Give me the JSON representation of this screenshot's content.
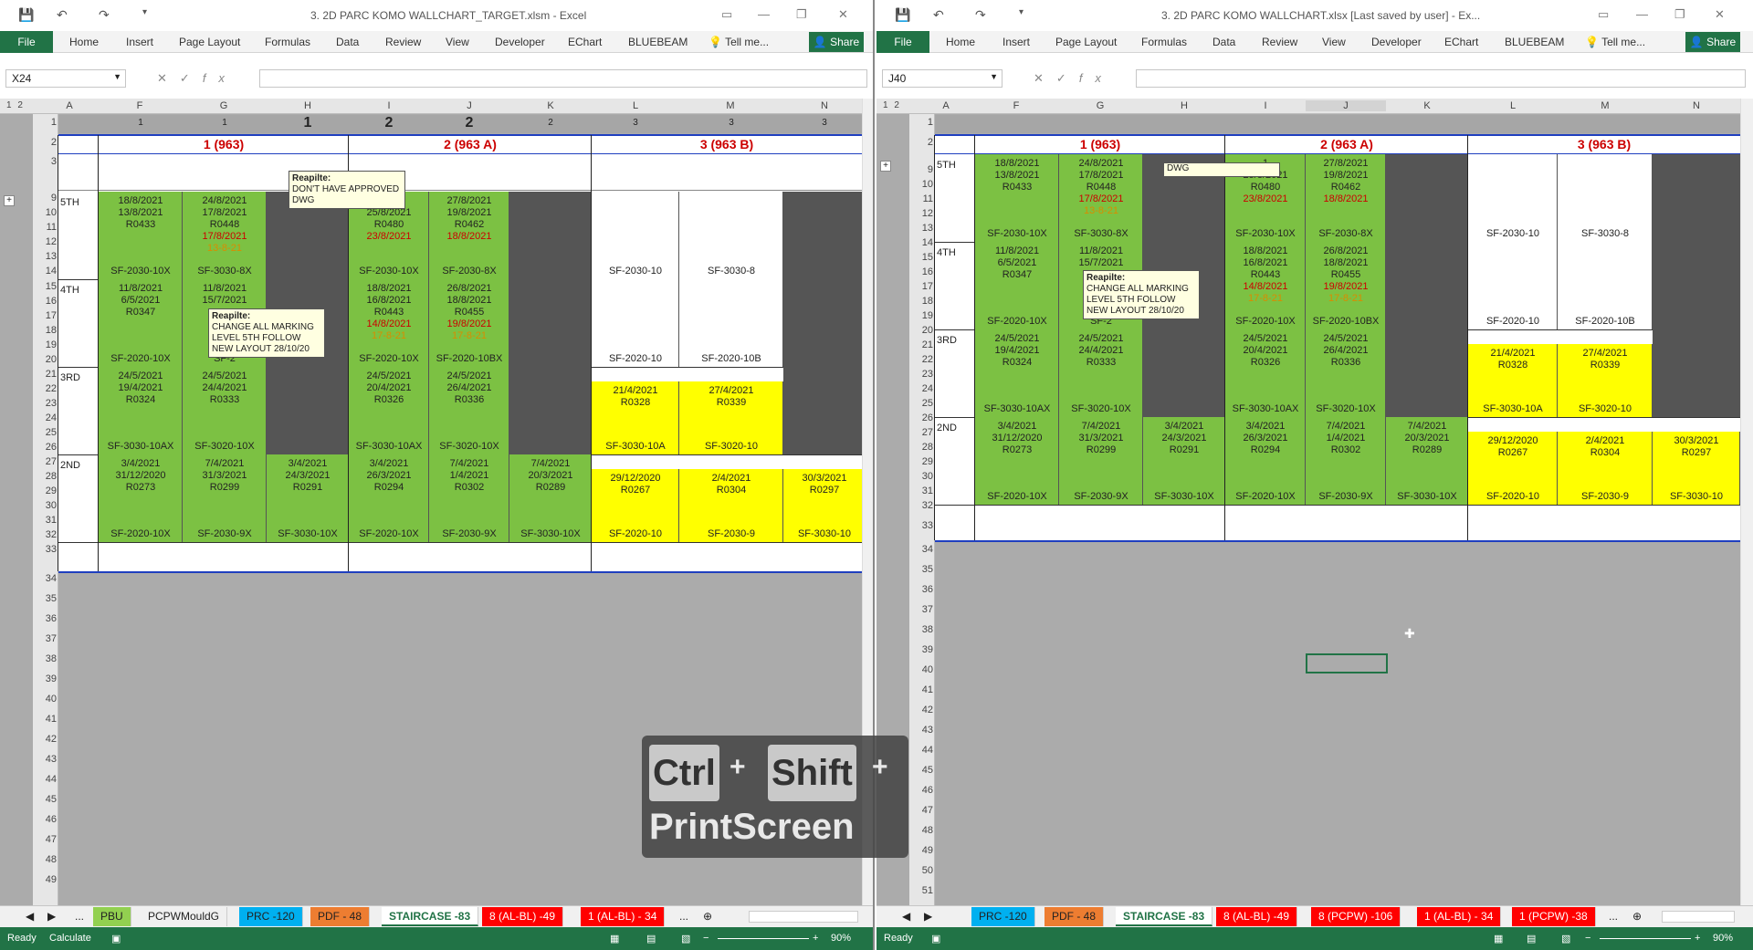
{
  "left": {
    "title": "3. 2D PARC KOMO WALLCHART_TARGET.xlsm - Excel",
    "name_box": "X24",
    "cols": [
      "A",
      "F",
      "G",
      "H",
      "I",
      "J",
      "K",
      "L",
      "M",
      "N"
    ],
    "tabs": [
      "PBU",
      "PCPWMouldG",
      "PRC -120",
      "PDF - 48",
      "STAIRCASE -83",
      "8 (AL-BL) -49",
      "1 (AL-BL) - 34"
    ],
    "status_ready": "Ready",
    "status_calc": "Calculate",
    "zoom": "90%",
    "note1": {
      "title": "Reapilte:",
      "text": "DON'T HAVE APPROVED DWG"
    },
    "note2": {
      "title": "Reapilte:",
      "text": "CHANGE ALL MARKING LEVEL 5TH FOLLOW NEW LAYOUT 28/10/20"
    }
  },
  "right": {
    "title": "3. 2D PARC KOMO WALLCHART.xlsx [Last saved by user] - Ex...",
    "name_box": "J40",
    "cols": [
      "A",
      "F",
      "G",
      "H",
      "I",
      "J",
      "K",
      "L",
      "M",
      "N"
    ],
    "tabs": [
      "PRC -120",
      "PDF - 48",
      "STAIRCASE -83",
      "8 (AL-BL) -49",
      "8 (PCPW) -106",
      "1 (AL-BL) - 34",
      "1 (PCPW) -38"
    ],
    "status_ready": "Ready",
    "zoom": "90%",
    "note1": {
      "text": "DWG"
    },
    "note2": {
      "title": "Reapilte:",
      "text": "CHANGE ALL MARKING LEVEL 5TH FOLLOW NEW LAYOUT 28/10/20"
    }
  },
  "ribbon": [
    "Home",
    "Insert",
    "Page Layout",
    "Formulas",
    "Data",
    "Review",
    "View",
    "Developer",
    "EChart",
    "BLUEBEAM",
    "Tell me..."
  ],
  "file_tab": "File",
  "share": "Share",
  "groups": {
    "g1": "1 (963)",
    "g2": "2 (963 A)",
    "g3": "3 (963 B)"
  },
  "row1_nums": [
    "1",
    "1",
    "1",
    "2",
    "2",
    "2",
    "3",
    "3",
    "3"
  ],
  "levels": [
    "5TH",
    "4TH",
    "3RD",
    "2ND"
  ],
  "grid": {
    "5TH": [
      {
        "l": [
          "18/8/2021",
          "13/8/2021",
          "R0433"
        ],
        "b": "SF-2030-10X",
        "c": "grn"
      },
      {
        "l": [
          "24/8/2021",
          "17/8/2021",
          "R0448"
        ],
        "r": "17/8/2021",
        "o": "13-8-21",
        "b": "SF-3030-8X",
        "c": "grn"
      },
      {
        "c": "dk"
      },
      {
        "l": [
          "1",
          "25/8/2021",
          "R0480"
        ],
        "r": "23/8/2021",
        "b": "SF-2030-10X",
        "c": "grn"
      },
      {
        "l": [
          "27/8/2021",
          "19/8/2021",
          "R0462"
        ],
        "r": "18/8/2021",
        "b": "SF-2030-8X",
        "c": "grn"
      },
      {
        "c": "dk"
      },
      {
        "b": "SF-2030-10",
        "c": "wh"
      },
      {
        "b": "SF-3030-8",
        "c": "wh"
      },
      {
        "c": "dk"
      }
    ],
    "4TH": [
      {
        "l": [
          "11/8/2021",
          "6/5/2021",
          "R0347"
        ],
        "b": "SF-2020-10X",
        "c": "grn"
      },
      {
        "l": [
          "11/8/2021",
          "15/7/2021",
          ""
        ],
        "b": "SF-2",
        "c": "grn"
      },
      {
        "c": "dk"
      },
      {
        "l": [
          "18/8/2021",
          "16/8/2021",
          "R0443"
        ],
        "r": "14/8/2021",
        "o": "17-8-21",
        "b": "SF-2020-10X",
        "c": "grn"
      },
      {
        "l": [
          "26/8/2021",
          "18/8/2021",
          "R0455"
        ],
        "r": "19/8/2021",
        "o": "17-8-21",
        "b": "SF-2020-10BX",
        "c": "grn"
      },
      {
        "c": "dk"
      },
      {
        "b": "SF-2020-10",
        "c": "wh"
      },
      {
        "b": "SF-2020-10B",
        "c": "wh"
      },
      {
        "c": "dk"
      }
    ],
    "3RD": [
      {
        "l": [
          "24/5/2021",
          "19/4/2021",
          "R0324"
        ],
        "b": "SF-3030-10AX",
        "c": "grn"
      },
      {
        "l": [
          "24/5/2021",
          "24/4/2021",
          "R0333"
        ],
        "b": "SF-3020-10X",
        "c": "grn"
      },
      {
        "c": "dk"
      },
      {
        "l": [
          "24/5/2021",
          "20/4/2021",
          "R0326"
        ],
        "b": "SF-3030-10AX",
        "c": "grn"
      },
      {
        "l": [
          "24/5/2021",
          "26/4/2021",
          "R0336"
        ],
        "b": "SF-3020-10X",
        "c": "grn"
      },
      {
        "c": "dk"
      },
      {
        "l": [
          "21/4/2021",
          "R0328"
        ],
        "b": "SF-3030-10A",
        "c": "yel"
      },
      {
        "l": [
          "27/4/2021",
          "R0339"
        ],
        "b": "SF-3020-10",
        "c": "yel"
      },
      {
        "c": "dk"
      }
    ],
    "2ND": [
      {
        "l": [
          "3/4/2021",
          "31/12/2020",
          "R0273"
        ],
        "b": "SF-2020-10X",
        "c": "grn"
      },
      {
        "l": [
          "7/4/2021",
          "31/3/2021",
          "R0299"
        ],
        "b": "SF-2030-9X",
        "c": "grn"
      },
      {
        "l": [
          "3/4/2021",
          "24/3/2021",
          "R0291"
        ],
        "b": "SF-3030-10X",
        "c": "grn"
      },
      {
        "l": [
          "3/4/2021",
          "26/3/2021",
          "R0294"
        ],
        "b": "SF-2020-10X",
        "c": "grn"
      },
      {
        "l": [
          "7/4/2021",
          "1/4/2021",
          "R0302"
        ],
        "b": "SF-2030-9X",
        "c": "grn"
      },
      {
        "l": [
          "7/4/2021",
          "20/3/2021",
          "R0289"
        ],
        "b": "SF-3030-10X",
        "c": "grn"
      },
      {
        "l": [
          "29/12/2020",
          "R0267"
        ],
        "b": "SF-2020-10",
        "c": "yel"
      },
      {
        "l": [
          "2/4/2021",
          "R0304"
        ],
        "b": "SF-2030-9",
        "c": "yel"
      },
      {
        "l": [
          "30/3/2021",
          "R0297"
        ],
        "b": "SF-3030-10",
        "c": "yel"
      }
    ]
  },
  "left_rows": [
    "1",
    "2",
    "3",
    "9",
    "10",
    "11",
    "12",
    "13",
    "14",
    "15",
    "16",
    "17",
    "18",
    "19",
    "20",
    "21",
    "22",
    "23",
    "24",
    "25",
    "26",
    "27",
    "28",
    "29",
    "30",
    "31",
    "32",
    "33",
    "34",
    "35",
    "36",
    "37",
    "38",
    "39",
    "40",
    "41",
    "42",
    "43",
    "44",
    "45",
    "46",
    "47",
    "48",
    "49"
  ],
  "right_rows": [
    "1",
    "2",
    "9",
    "10",
    "11",
    "12",
    "13",
    "14",
    "15",
    "16",
    "17",
    "18",
    "19",
    "20",
    "21",
    "22",
    "23",
    "24",
    "25",
    "26",
    "27",
    "28",
    "29",
    "30",
    "31",
    "32",
    "33",
    "34",
    "35",
    "36",
    "37",
    "38",
    "39",
    "40",
    "41",
    "42",
    "43",
    "44",
    "45",
    "46",
    "47",
    "48",
    "49",
    "50",
    "51"
  ],
  "overlay": {
    "k1": "Ctrl",
    "plus": "+",
    "k2": "Shift",
    "k3": "PrintScreen"
  }
}
